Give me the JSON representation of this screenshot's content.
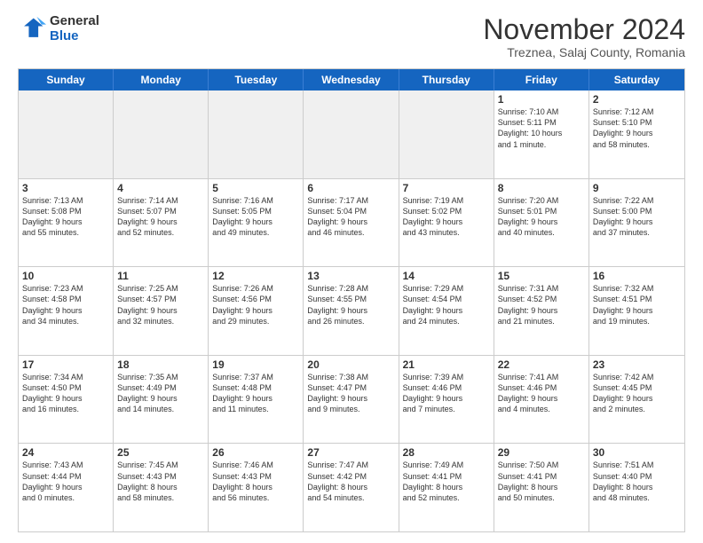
{
  "logo": {
    "general": "General",
    "blue": "Blue"
  },
  "title": {
    "month": "November 2024",
    "location": "Treznea, Salaj County, Romania"
  },
  "header_days": [
    "Sunday",
    "Monday",
    "Tuesday",
    "Wednesday",
    "Thursday",
    "Friday",
    "Saturday"
  ],
  "weeks": [
    [
      {
        "day": "",
        "info": ""
      },
      {
        "day": "",
        "info": ""
      },
      {
        "day": "",
        "info": ""
      },
      {
        "day": "",
        "info": ""
      },
      {
        "day": "",
        "info": ""
      },
      {
        "day": "1",
        "info": "Sunrise: 7:10 AM\nSunset: 5:11 PM\nDaylight: 10 hours\nand 1 minute."
      },
      {
        "day": "2",
        "info": "Sunrise: 7:12 AM\nSunset: 5:10 PM\nDaylight: 9 hours\nand 58 minutes."
      }
    ],
    [
      {
        "day": "3",
        "info": "Sunrise: 7:13 AM\nSunset: 5:08 PM\nDaylight: 9 hours\nand 55 minutes."
      },
      {
        "day": "4",
        "info": "Sunrise: 7:14 AM\nSunset: 5:07 PM\nDaylight: 9 hours\nand 52 minutes."
      },
      {
        "day": "5",
        "info": "Sunrise: 7:16 AM\nSunset: 5:05 PM\nDaylight: 9 hours\nand 49 minutes."
      },
      {
        "day": "6",
        "info": "Sunrise: 7:17 AM\nSunset: 5:04 PM\nDaylight: 9 hours\nand 46 minutes."
      },
      {
        "day": "7",
        "info": "Sunrise: 7:19 AM\nSunset: 5:02 PM\nDaylight: 9 hours\nand 43 minutes."
      },
      {
        "day": "8",
        "info": "Sunrise: 7:20 AM\nSunset: 5:01 PM\nDaylight: 9 hours\nand 40 minutes."
      },
      {
        "day": "9",
        "info": "Sunrise: 7:22 AM\nSunset: 5:00 PM\nDaylight: 9 hours\nand 37 minutes."
      }
    ],
    [
      {
        "day": "10",
        "info": "Sunrise: 7:23 AM\nSunset: 4:58 PM\nDaylight: 9 hours\nand 34 minutes."
      },
      {
        "day": "11",
        "info": "Sunrise: 7:25 AM\nSunset: 4:57 PM\nDaylight: 9 hours\nand 32 minutes."
      },
      {
        "day": "12",
        "info": "Sunrise: 7:26 AM\nSunset: 4:56 PM\nDaylight: 9 hours\nand 29 minutes."
      },
      {
        "day": "13",
        "info": "Sunrise: 7:28 AM\nSunset: 4:55 PM\nDaylight: 9 hours\nand 26 minutes."
      },
      {
        "day": "14",
        "info": "Sunrise: 7:29 AM\nSunset: 4:54 PM\nDaylight: 9 hours\nand 24 minutes."
      },
      {
        "day": "15",
        "info": "Sunrise: 7:31 AM\nSunset: 4:52 PM\nDaylight: 9 hours\nand 21 minutes."
      },
      {
        "day": "16",
        "info": "Sunrise: 7:32 AM\nSunset: 4:51 PM\nDaylight: 9 hours\nand 19 minutes."
      }
    ],
    [
      {
        "day": "17",
        "info": "Sunrise: 7:34 AM\nSunset: 4:50 PM\nDaylight: 9 hours\nand 16 minutes."
      },
      {
        "day": "18",
        "info": "Sunrise: 7:35 AM\nSunset: 4:49 PM\nDaylight: 9 hours\nand 14 minutes."
      },
      {
        "day": "19",
        "info": "Sunrise: 7:37 AM\nSunset: 4:48 PM\nDaylight: 9 hours\nand 11 minutes."
      },
      {
        "day": "20",
        "info": "Sunrise: 7:38 AM\nSunset: 4:47 PM\nDaylight: 9 hours\nand 9 minutes."
      },
      {
        "day": "21",
        "info": "Sunrise: 7:39 AM\nSunset: 4:46 PM\nDaylight: 9 hours\nand 7 minutes."
      },
      {
        "day": "22",
        "info": "Sunrise: 7:41 AM\nSunset: 4:46 PM\nDaylight: 9 hours\nand 4 minutes."
      },
      {
        "day": "23",
        "info": "Sunrise: 7:42 AM\nSunset: 4:45 PM\nDaylight: 9 hours\nand 2 minutes."
      }
    ],
    [
      {
        "day": "24",
        "info": "Sunrise: 7:43 AM\nSunset: 4:44 PM\nDaylight: 9 hours\nand 0 minutes."
      },
      {
        "day": "25",
        "info": "Sunrise: 7:45 AM\nSunset: 4:43 PM\nDaylight: 8 hours\nand 58 minutes."
      },
      {
        "day": "26",
        "info": "Sunrise: 7:46 AM\nSunset: 4:43 PM\nDaylight: 8 hours\nand 56 minutes."
      },
      {
        "day": "27",
        "info": "Sunrise: 7:47 AM\nSunset: 4:42 PM\nDaylight: 8 hours\nand 54 minutes."
      },
      {
        "day": "28",
        "info": "Sunrise: 7:49 AM\nSunset: 4:41 PM\nDaylight: 8 hours\nand 52 minutes."
      },
      {
        "day": "29",
        "info": "Sunrise: 7:50 AM\nSunset: 4:41 PM\nDaylight: 8 hours\nand 50 minutes."
      },
      {
        "day": "30",
        "info": "Sunrise: 7:51 AM\nSunset: 4:40 PM\nDaylight: 8 hours\nand 48 minutes."
      }
    ]
  ]
}
